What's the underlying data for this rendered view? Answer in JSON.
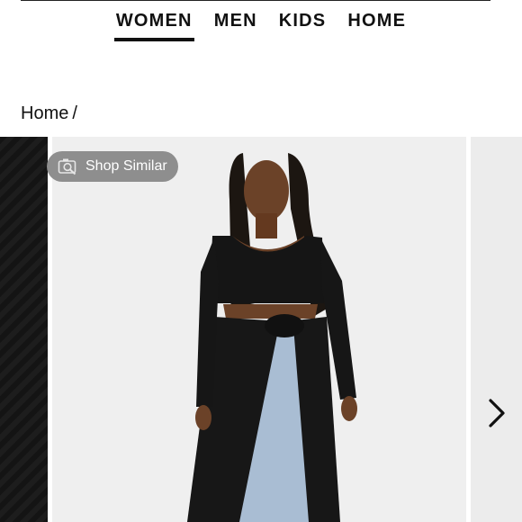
{
  "nav": {
    "tabs": [
      {
        "label": "WOMEN",
        "active": true
      },
      {
        "label": "MEN",
        "active": false
      },
      {
        "label": "KIDS",
        "active": false
      },
      {
        "label": "HOME",
        "active": false
      }
    ]
  },
  "breadcrumb": {
    "home": "Home",
    "separator": "/"
  },
  "gallery": {
    "shop_similar_label": "Shop Similar",
    "shop_similar_icon": "camera-search-icon",
    "next_icon": "chevron-right-icon"
  },
  "colors": {
    "pill_bg": "#8e8e8e",
    "accent": "#111111",
    "slide_bg": "#efefef"
  }
}
